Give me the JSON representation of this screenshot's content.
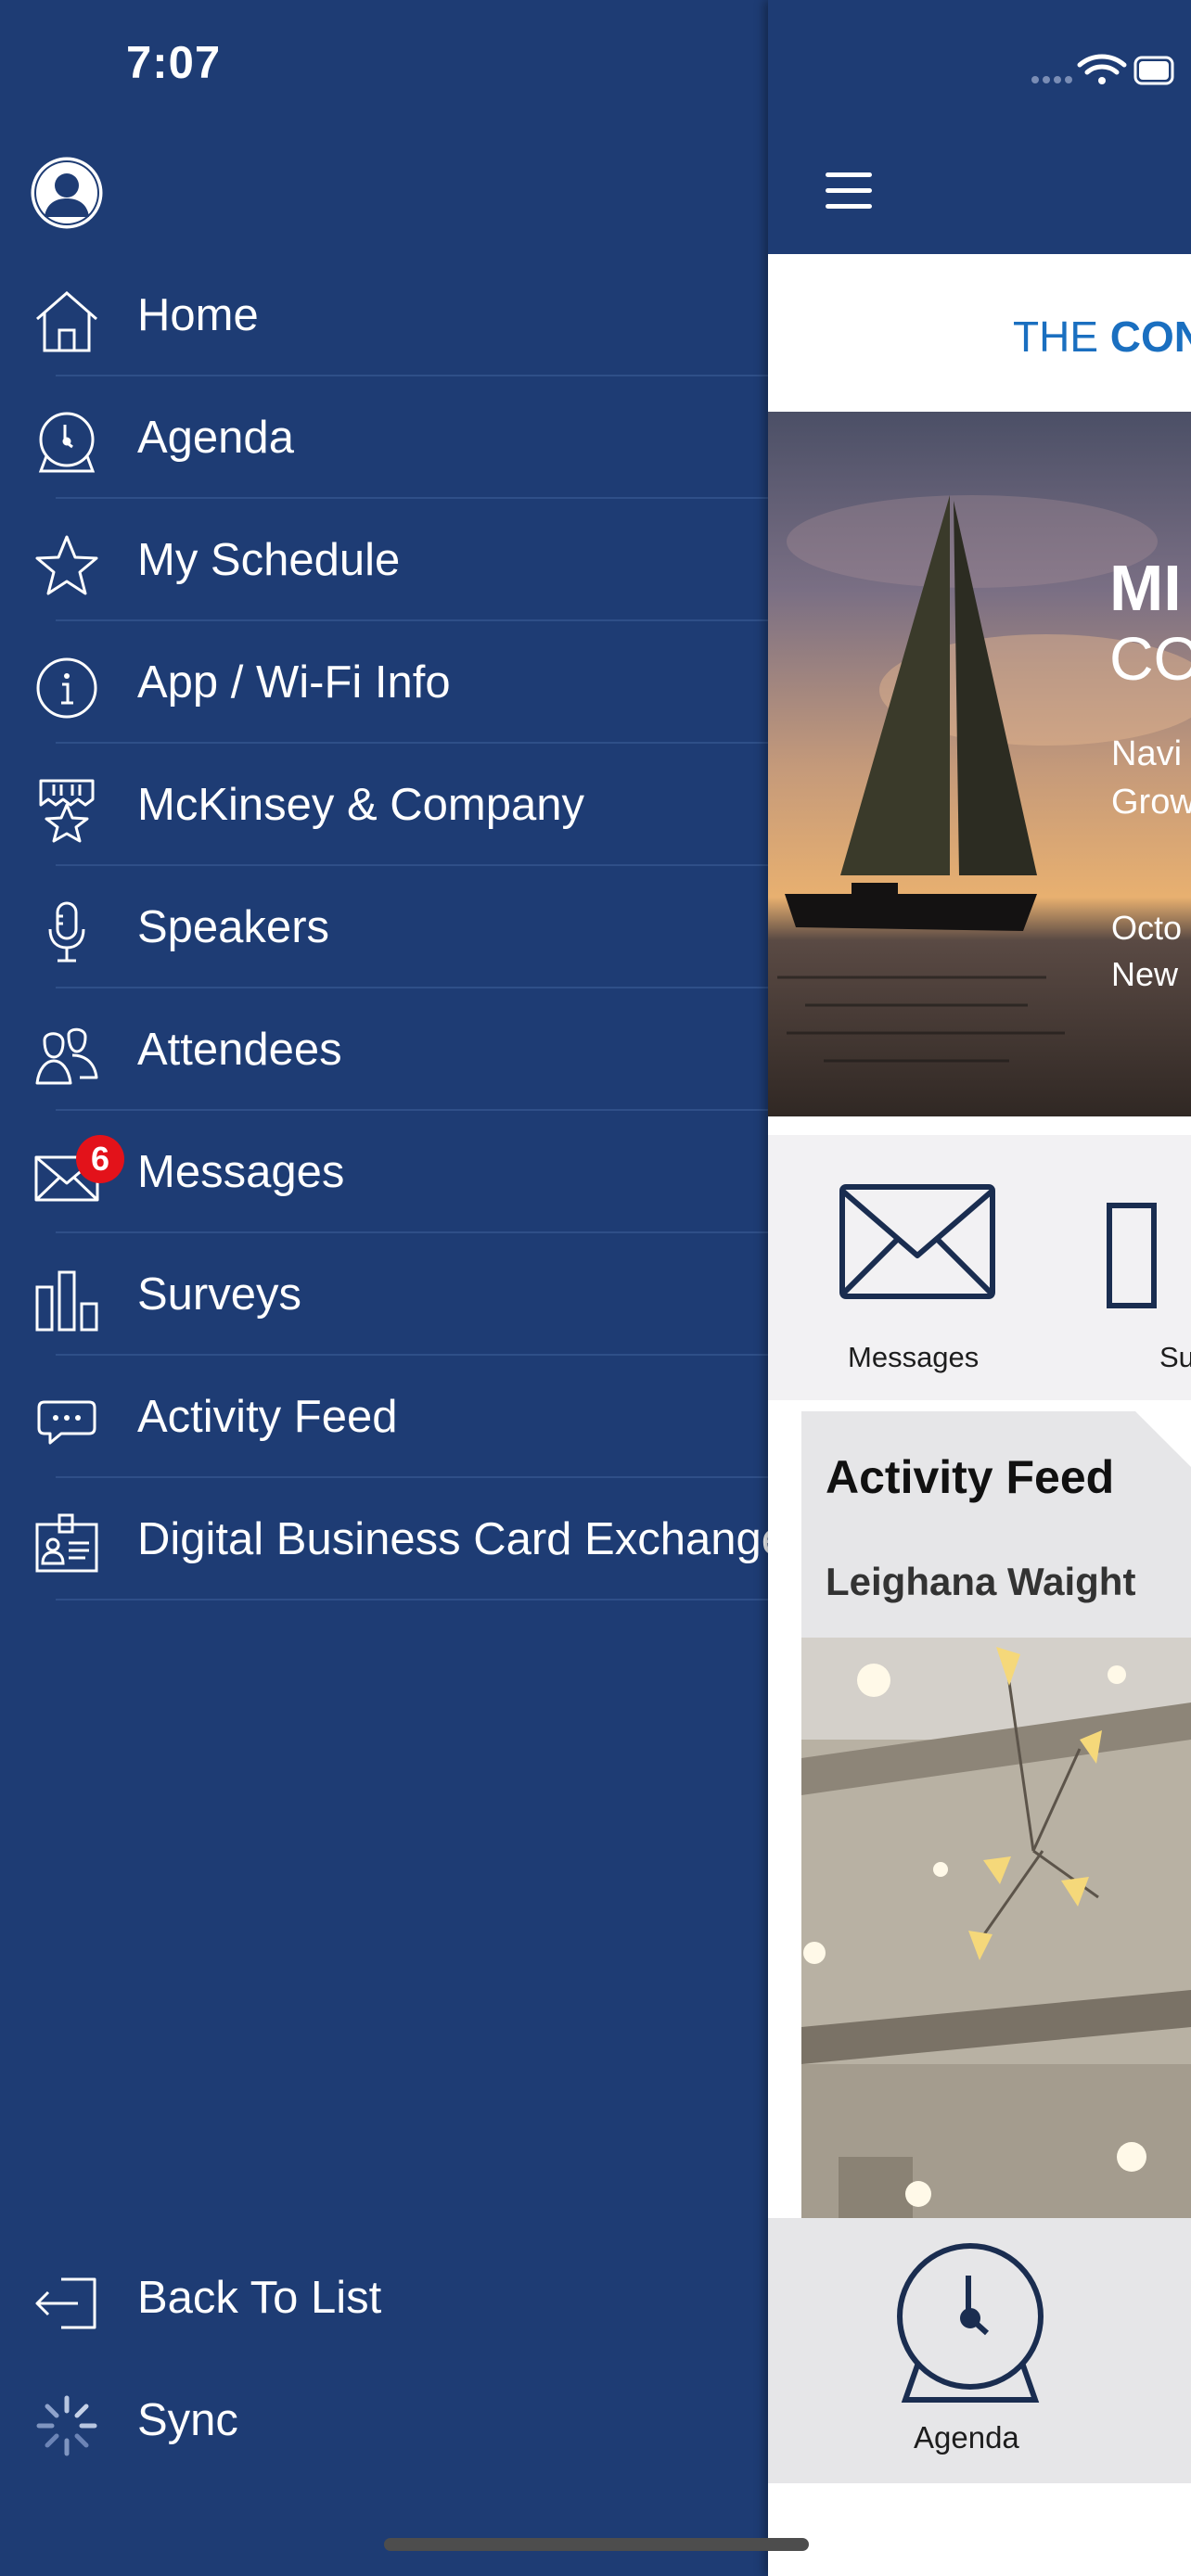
{
  "status_bar": {
    "time": "7:07"
  },
  "drawer": {
    "menu": [
      {
        "id": "home",
        "label": "Home",
        "icon": "home-icon"
      },
      {
        "id": "agenda",
        "label": "Agenda",
        "icon": "clock-icon"
      },
      {
        "id": "my-schedule",
        "label": "My Schedule",
        "icon": "star-icon"
      },
      {
        "id": "app-info",
        "label": "App / Wi-Fi Info",
        "icon": "info-icon"
      },
      {
        "id": "mckinsey",
        "label": "McKinsey & Company",
        "icon": "sponsor-star-icon"
      },
      {
        "id": "speakers",
        "label": "Speakers",
        "icon": "microphone-icon"
      },
      {
        "id": "attendees",
        "label": "Attendees",
        "icon": "people-icon"
      },
      {
        "id": "messages",
        "label": "Messages",
        "icon": "envelope-icon",
        "badge": "6"
      },
      {
        "id": "surveys",
        "label": "Surveys",
        "icon": "bar-chart-icon"
      },
      {
        "id": "activity-feed",
        "label": "Activity Feed",
        "icon": "chat-bubble-icon"
      },
      {
        "id": "business-card",
        "label": "Digital Business Card Exchange",
        "icon": "id-card-icon"
      }
    ],
    "bottom": [
      {
        "id": "back-to-list",
        "label": "Back To List",
        "icon": "exit-icon"
      },
      {
        "id": "sync",
        "label": "Sync",
        "icon": "spinner-icon"
      }
    ]
  },
  "main": {
    "logo": {
      "prefix": "THE ",
      "bold": "CON"
    },
    "hero": {
      "line1": "MI",
      "line2": "CO",
      "line3": "Navi",
      "line4": "Grow",
      "line5": "Octo",
      "line6": "New"
    },
    "tiles": [
      {
        "label": "Messages",
        "icon": "envelope-icon"
      },
      {
        "label": "Su",
        "icon": "survey-icon"
      }
    ],
    "activity_card": {
      "title": "Activity Feed",
      "author": "Leighana Waight"
    },
    "footer_tile": {
      "label": "Agenda",
      "icon": "clock-icon"
    }
  },
  "colors": {
    "drawer_bg": "#1e3c74",
    "accent": "#1a6fc0",
    "badge": "#e3121a"
  }
}
